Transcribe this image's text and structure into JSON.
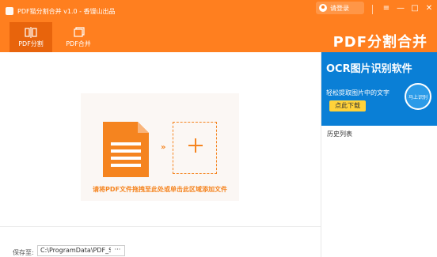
{
  "window": {
    "title": "PDF猫分割合并 v1.0 - 香馒山出品",
    "login_label": "请登录"
  },
  "window_controls": {
    "menu": "≡",
    "minimize": "—",
    "maximize": "□",
    "close": "✕"
  },
  "toolbar": {
    "tabs": [
      {
        "label": "PDF分割",
        "active": true,
        "icon": "split-icon"
      },
      {
        "label": "PDF合并",
        "active": false,
        "icon": "merge-icon"
      }
    ],
    "brand_title": "PDF分割合并"
  },
  "main": {
    "drop_hint": "请将PDF文件拖拽至此处或单击此区域添加文件",
    "arrow": "»",
    "save_label": "保存至:",
    "save_path": "C:\\ProgramData\\PDF_S",
    "browse_label": "···"
  },
  "sidebar": {
    "ad": {
      "title": "OCR图片识别软件",
      "subtitle": "轻松提取图片中的文字",
      "button": "点此下载",
      "badge": "马上识别"
    },
    "history_label": "历史列表"
  },
  "colors": {
    "accent": "#ff7f1f",
    "accent_dark": "#e8640c",
    "file_icon": "#f5841f",
    "ad_bg": "#0a7fd6",
    "ad_button": "#ffd23a"
  }
}
